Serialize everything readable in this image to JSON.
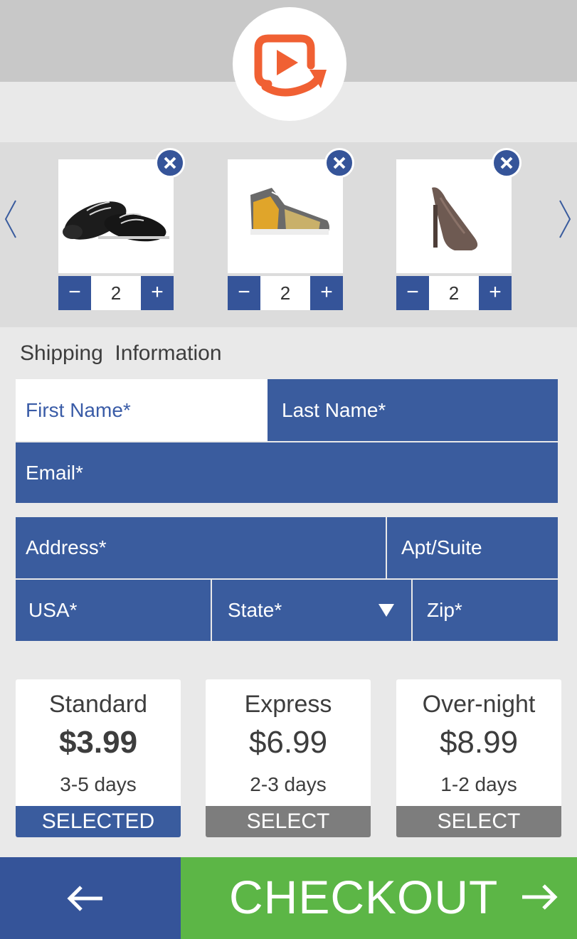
{
  "header": {
    "logo_icon": "play-refresh-logo-icon",
    "logo_color": "#f06033"
  },
  "carousel": {
    "prev_icon": "chevron-left-icon",
    "next_icon": "chevron-right-icon",
    "products": [
      {
        "image": "black-loafer-shoes",
        "quantity": "2",
        "remove_icon": "close-icon",
        "minus": "−",
        "plus": "+"
      },
      {
        "image": "patterned-high-top-sneaker",
        "quantity": "2",
        "remove_icon": "close-icon",
        "minus": "−",
        "plus": "+"
      },
      {
        "image": "taupe-high-heel-pump",
        "quantity": "2",
        "remove_icon": "close-icon",
        "minus": "−",
        "plus": "+"
      }
    ]
  },
  "shipping_form": {
    "title": "Shipping  Information",
    "first_name": "First Name*",
    "last_name": "Last Name*",
    "email": "Email*",
    "address": "Address*",
    "apt": "Apt/Suite",
    "country": "USA*",
    "state": "State*",
    "state_icon": "dropdown-triangle-icon",
    "zip": "Zip*"
  },
  "shipping_options": [
    {
      "name": "Standard",
      "price": "$3.99",
      "days": "3-5 days",
      "button": "SELECTED"
    },
    {
      "name": "Express",
      "price": "$6.99",
      "days": "2-3 days",
      "button": "SELECT"
    },
    {
      "name": "Over-night",
      "price": "$8.99",
      "days": "1-2 days",
      "button": "SELECT"
    }
  ],
  "footer": {
    "back_icon": "arrow-left-icon",
    "checkout_label": "CHECKOUT",
    "checkout_icon": "arrow-right-icon"
  },
  "colors": {
    "primary_blue": "#3a5c9e",
    "checkout_green": "#5cb646",
    "unselected_gray": "#7d7d7d"
  }
}
